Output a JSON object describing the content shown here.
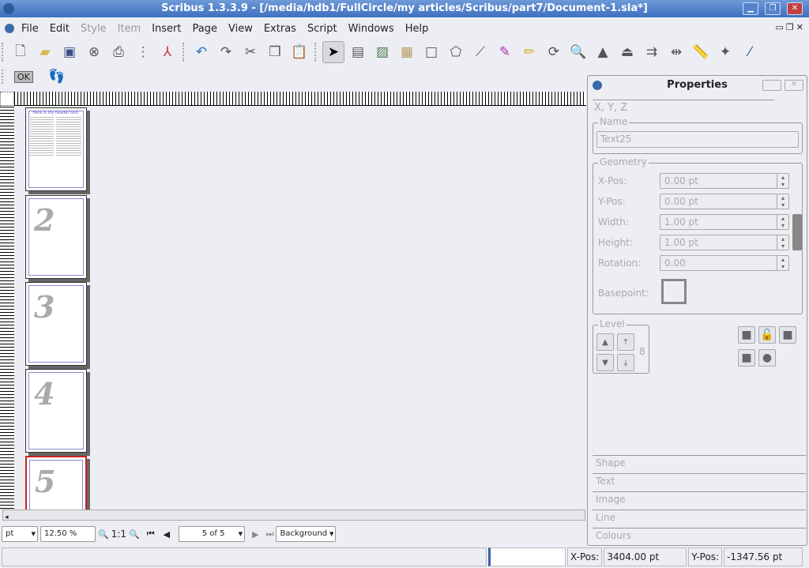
{
  "window": {
    "title": "Scribus 1.3.3.9 - [/media/hdb1/FullCircle/my articles/Scribus/part7/Document-1.sla*]",
    "min": "▁",
    "max": "❐",
    "close": "✕"
  },
  "menu": [
    "File",
    "Edit",
    "Style",
    "Item",
    "Insert",
    "Page",
    "View",
    "Extras",
    "Script",
    "Windows",
    "Help"
  ],
  "toolbar": {
    "ok_label": "OK"
  },
  "pages": [
    {
      "label": ""
    },
    {
      "label": "2"
    },
    {
      "label": "3"
    },
    {
      "label": "4"
    },
    {
      "label": "5"
    }
  ],
  "page1_header": "Here is my header text.",
  "bottom": {
    "unit": "pt",
    "zoom": "12.50 %",
    "one_to_one": "1:1",
    "page_select": "5 of 5",
    "layer": "Background"
  },
  "status": {
    "xpos_label": "X-Pos:",
    "xpos": "3404.00 pt",
    "ypos_label": "Y-Pos:",
    "ypos": "-1347.56 pt"
  },
  "properties": {
    "title": "Properties",
    "tab": "X, Y, Z",
    "name_group": "Name",
    "name_value": "Text25",
    "geometry_group": "Geometry",
    "fields": [
      {
        "label": "X-Pos:",
        "value": "0.00 pt"
      },
      {
        "label": "Y-Pos:",
        "value": "0.00 pt"
      },
      {
        "label": "Width:",
        "value": "1.00 pt"
      },
      {
        "label": "Height:",
        "value": "1.00 pt"
      },
      {
        "label": "Rotation:",
        "value": "0.00"
      }
    ],
    "basepoint": "Basepoint:",
    "level_group": "Level",
    "level_value": "8",
    "tabs": [
      "Shape",
      "Text",
      "Image",
      "Line",
      "Colours"
    ]
  }
}
